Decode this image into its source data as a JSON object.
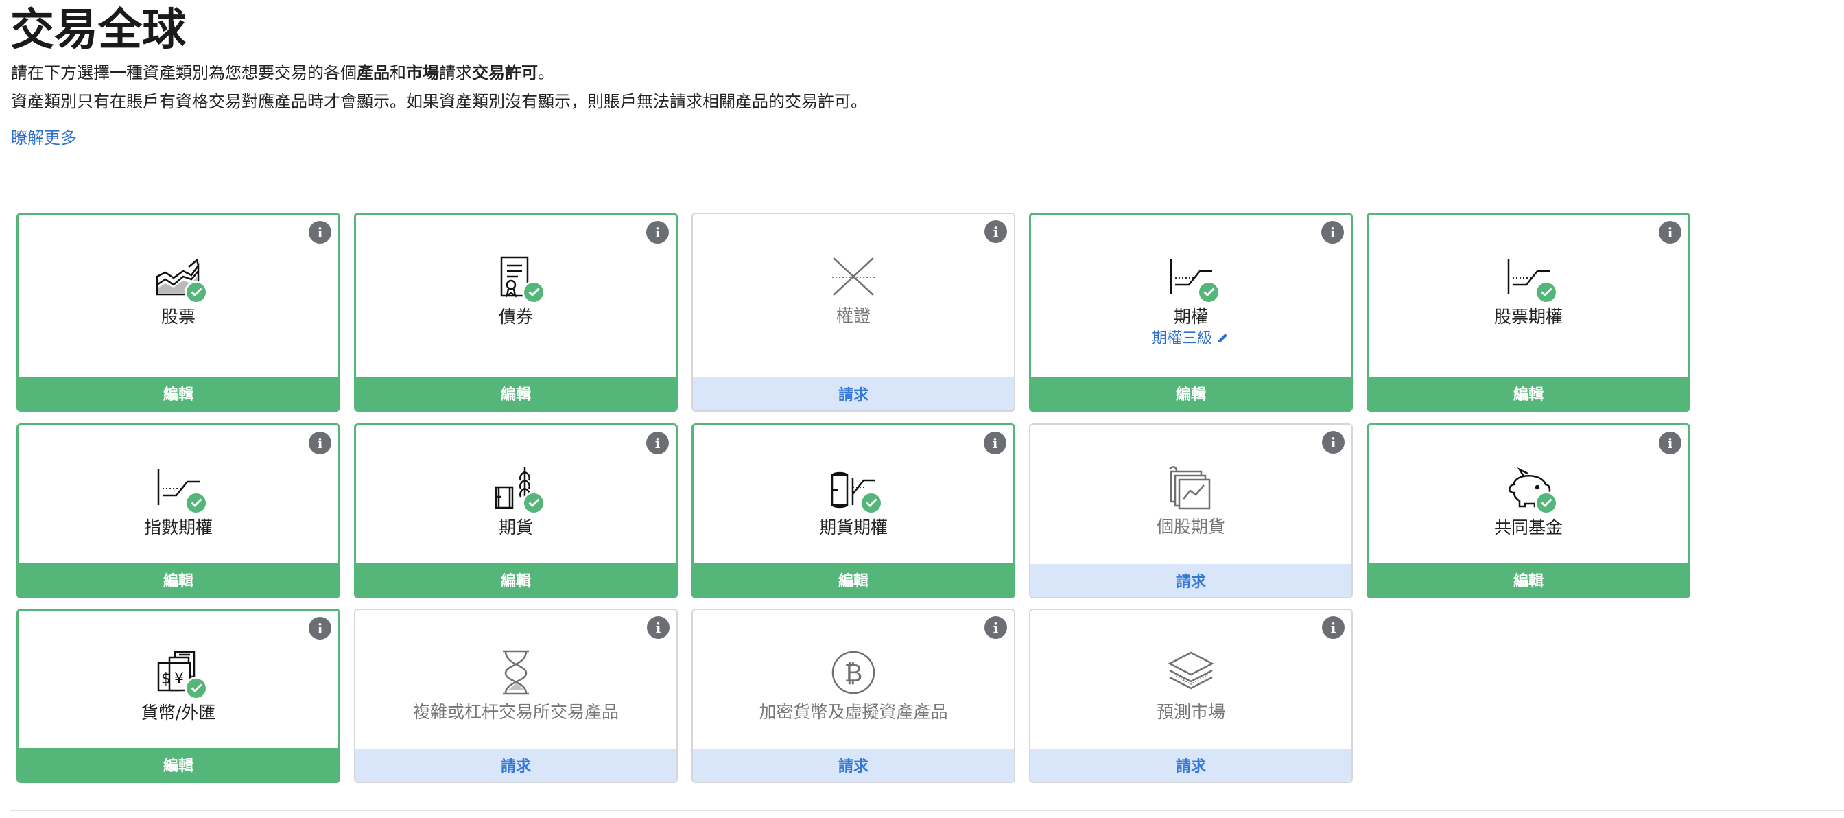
{
  "page": {
    "title": "交易全球",
    "line1": {
      "p1": "請在下方選擇一種資產類別為您想要交易的各個",
      "b1": "產品",
      "p2": "和",
      "b2": "市場",
      "p3": "請求",
      "b3": "交易許可",
      "p4": "。"
    },
    "line2": "資產類別只有在賬戶有資格交易對應產品時才會顯示。如果資產類別沒有顯示，則賬戶無法請求相關產品的交易許可。",
    "learn_more": "瞭解更多"
  },
  "info_glyph": "i",
  "colors": {
    "enabled": "#55b679",
    "request_bg": "#d9e5f9",
    "request_text": "#3478d8",
    "link": "#2f6fd1"
  },
  "cards": [
    {
      "label": "股票",
      "action": "編輯",
      "status": "enabled",
      "icon": "stock-chart-icon"
    },
    {
      "label": "債券",
      "action": "編輯",
      "status": "enabled",
      "icon": "bond-certificate-icon"
    },
    {
      "label": "權證",
      "action": "請求",
      "status": "requestable",
      "icon": "warrant-cross-icon"
    },
    {
      "label": "期權",
      "sublabel": "期權三級",
      "action": "編輯",
      "status": "enabled",
      "icon": "option-payoff-icon"
    },
    {
      "label": "股票期權",
      "action": "編輯",
      "status": "enabled",
      "icon": "option-payoff-icon"
    },
    {
      "label": "指數期權",
      "action": "編輯",
      "status": "enabled",
      "icon": "option-payoff-icon"
    },
    {
      "label": "期貨",
      "action": "編輯",
      "status": "enabled",
      "icon": "futures-barrel-wheat-icon"
    },
    {
      "label": "期貨期權",
      "action": "編輯",
      "status": "enabled",
      "icon": "futures-option-icon"
    },
    {
      "label": "個股期貨",
      "action": "請求",
      "status": "requestable",
      "icon": "stacked-charts-icon"
    },
    {
      "label": "共同基金",
      "action": "編輯",
      "status": "enabled",
      "icon": "piggy-bank-icon"
    },
    {
      "label": "貨幣/外匯",
      "action": "編輯",
      "status": "enabled",
      "icon": "currency-notes-icon"
    },
    {
      "label": "複雜或杠杆交易所交易產品",
      "action": "請求",
      "status": "requestable",
      "icon": "hourglass-icon"
    },
    {
      "label": "加密貨幣及虛擬資產產品",
      "action": "請求",
      "status": "requestable",
      "icon": "bitcoin-icon"
    },
    {
      "label": "預測市場",
      "action": "請求",
      "status": "requestable",
      "icon": "layers-icon"
    }
  ]
}
